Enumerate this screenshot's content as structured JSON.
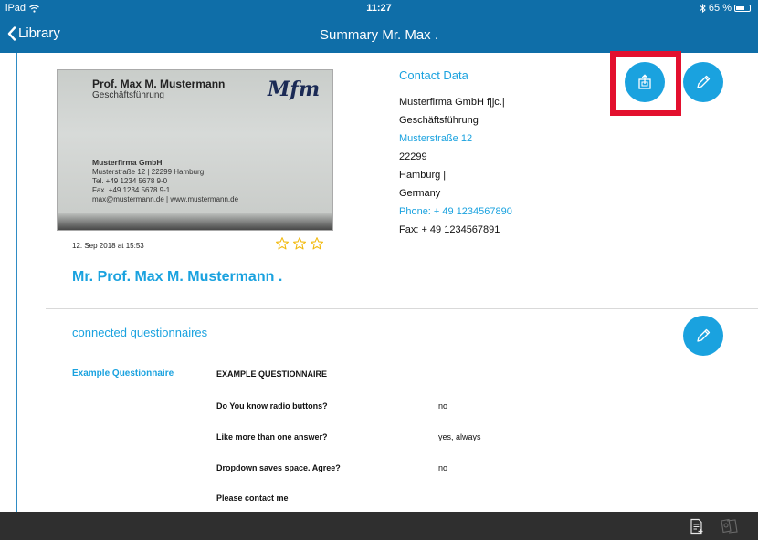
{
  "status_bar": {
    "device": "iPad",
    "time": "11:27",
    "battery": "65 %",
    "battery_level": 0.65
  },
  "nav": {
    "back_label": "Library",
    "title": "Summary Mr. Max ."
  },
  "card": {
    "name": "Prof. Max M. Mustermann",
    "role": "Geschäftsführung",
    "signature": "Mfm",
    "company": "Musterfirma GmbH",
    "address": "Musterstraße 12 | 22299 Hamburg",
    "tel": "Tel. +49 1234 5678 9-0",
    "fax": "Fax. +49 1234 5678 9-1",
    "web": "max@mustermann.de | www.mustermann.de"
  },
  "meta": {
    "date": "12. Sep 2018 at 15:53",
    "rating": 0,
    "rating_max": 3
  },
  "person_name": "Mr. Prof. Max M. Mustermann .",
  "contact": {
    "title": "Contact Data",
    "lines": [
      {
        "text": "Musterfirma GmbH f|jc.|",
        "link": false
      },
      {
        "text": "Geschäftsführung",
        "link": false
      },
      {
        "text": "Musterstraße 12",
        "link": true
      },
      {
        "text": "22299",
        "link": false
      },
      {
        "text": "Hamburg |",
        "link": false
      },
      {
        "text": "Germany",
        "link": false
      },
      {
        "text": "Phone: + 49 1234567890",
        "link": true
      },
      {
        "text": "Fax: + 49 1234567891",
        "link": false
      }
    ]
  },
  "questionnaires": {
    "section_title": "connected questionnaires",
    "name": "Example Questionnaire",
    "header": "EXAMPLE QUESTIONNAIRE",
    "rows": [
      {
        "question": "Do You know radio buttons?",
        "answer": "no"
      },
      {
        "question": "Like more than one answer?",
        "answer": "yes, always"
      },
      {
        "question": "Dropdown saves space. Agree?",
        "answer": "no"
      },
      {
        "question": "Please contact me",
        "answer": ""
      }
    ]
  },
  "colors": {
    "bar": "#0f6ea8",
    "accent": "#1aa2df",
    "highlight": "#e3102e",
    "toolbar": "#2f2f2f"
  },
  "icons": [
    "wifi-icon",
    "bluetooth-icon",
    "battery-icon",
    "chevron-left-icon",
    "share-icon",
    "edit-icon",
    "star-icon",
    "add-document-icon",
    "cards-icon"
  ]
}
